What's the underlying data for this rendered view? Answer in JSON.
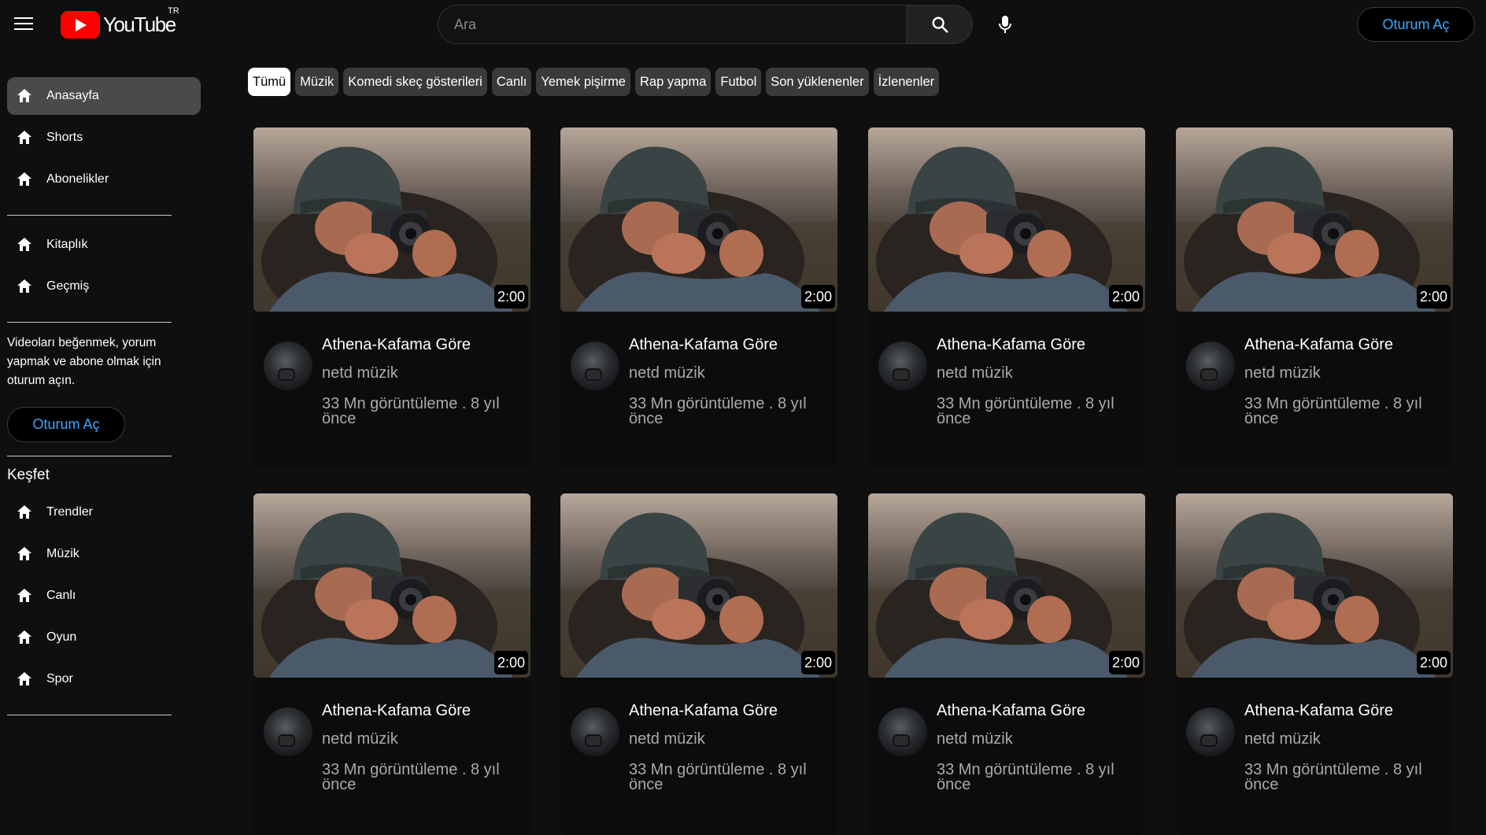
{
  "header": {
    "logo_text": "YouTube",
    "region": "TR",
    "search_placeholder": "Ara",
    "signin_label": "Oturum Aç"
  },
  "sidebar": {
    "primary": [
      {
        "label": "Anasayfa",
        "active": true
      },
      {
        "label": "Shorts"
      },
      {
        "label": "Abonelikler"
      }
    ],
    "secondary": [
      {
        "label": "Kitaplık"
      },
      {
        "label": "Geçmiş"
      }
    ],
    "signin_note": "Videoları beğenmek, yorum yapmak ve abone olmak için oturum açın.",
    "signin_label": "Oturum Aç",
    "explore_heading": "Keşfet",
    "explore": [
      {
        "label": "Trendler"
      },
      {
        "label": "Müzik"
      },
      {
        "label": "Canlı"
      },
      {
        "label": "Oyun"
      },
      {
        "label": "Spor"
      }
    ]
  },
  "chips": [
    "Tümü",
    "Müzik",
    "Komedi skeç gösterileri",
    "Canlı",
    "Yemek pişirme",
    "Rap yapma",
    "Futbol",
    "Son yüklenenler",
    "İzlenenler"
  ],
  "videos": [
    {
      "title": "Athena-Kafama Göre",
      "channel": "netd müzik",
      "meta": "33 Mn görüntüleme . 8 yıl önce",
      "duration": "2:00"
    },
    {
      "title": "Athena-Kafama Göre",
      "channel": "netd müzik",
      "meta": "33 Mn görüntüleme . 8 yıl önce",
      "duration": "2:00"
    },
    {
      "title": "Athena-Kafama Göre",
      "channel": "netd müzik",
      "meta": "33 Mn görüntüleme . 8 yıl önce",
      "duration": "2:00"
    },
    {
      "title": "Athena-Kafama Göre",
      "channel": "netd müzik",
      "meta": "33 Mn görüntüleme . 8 yıl önce",
      "duration": "2:00"
    },
    {
      "title": "Athena-Kafama Göre",
      "channel": "netd müzik",
      "meta": "33 Mn görüntüleme . 8 yıl önce",
      "duration": "2:00"
    },
    {
      "title": "Athena-Kafama Göre",
      "channel": "netd müzik",
      "meta": "33 Mn görüntüleme . 8 yıl önce",
      "duration": "2:00"
    },
    {
      "title": "Athena-Kafama Göre",
      "channel": "netd müzik",
      "meta": "33 Mn görüntüleme . 8 yıl önce",
      "duration": "2:00"
    },
    {
      "title": "Athena-Kafama Göre",
      "channel": "netd müzik",
      "meta": "33 Mn görüntüleme . 8 yıl önce",
      "duration": "2:00"
    }
  ],
  "colors": {
    "accent": "#3ea6ff",
    "brand": "#ff0000",
    "chip_active": "#ffffff",
    "chip": "#3a3a3a"
  }
}
